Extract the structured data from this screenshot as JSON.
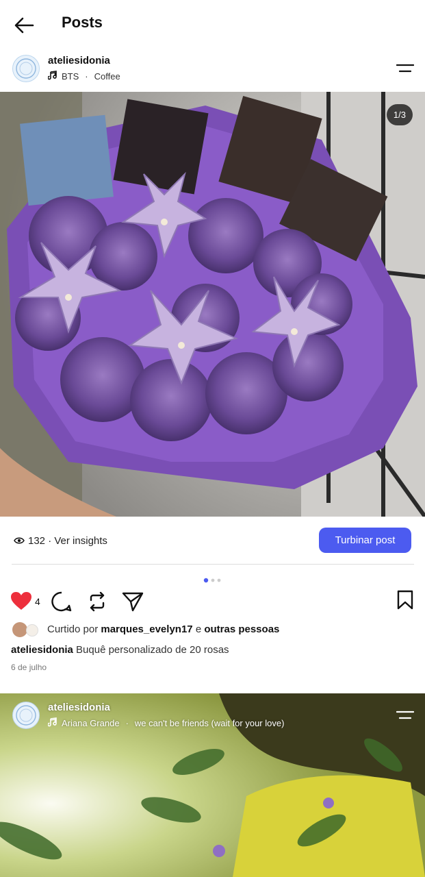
{
  "header": {
    "title": "Posts"
  },
  "post1": {
    "username": "ateliesidonia",
    "music": {
      "artist": "BTS",
      "song": "Coffee"
    },
    "carousel": {
      "counter": "1/3"
    },
    "insights": {
      "views": "132",
      "label": "Ver insights"
    },
    "boost_label": "Turbinar post",
    "likes_count": "4",
    "liked_by": {
      "prefix": "Curtido por",
      "user": "marques_evelyn17",
      "connector": "e",
      "others": "outras pessoas"
    },
    "caption": {
      "username": "ateliesidonia",
      "text": "Buquê personalizado de 20 rosas"
    },
    "date": "6 de julho"
  },
  "post2": {
    "username": "ateliesidonia",
    "music": {
      "artist": "Ariana Grande",
      "song": "we can't be friends (wait for your love)"
    }
  },
  "colors": {
    "accent": "#4c5bf0",
    "like_red": "#ed4956",
    "bouquet_purple": "#7a4fb5"
  },
  "icons": [
    "back-arrow-icon",
    "music-note-icon",
    "menu-lines-icon",
    "eye-icon",
    "heart-icon",
    "comment-icon",
    "repost-icon",
    "share-icon",
    "bookmark-icon"
  ]
}
